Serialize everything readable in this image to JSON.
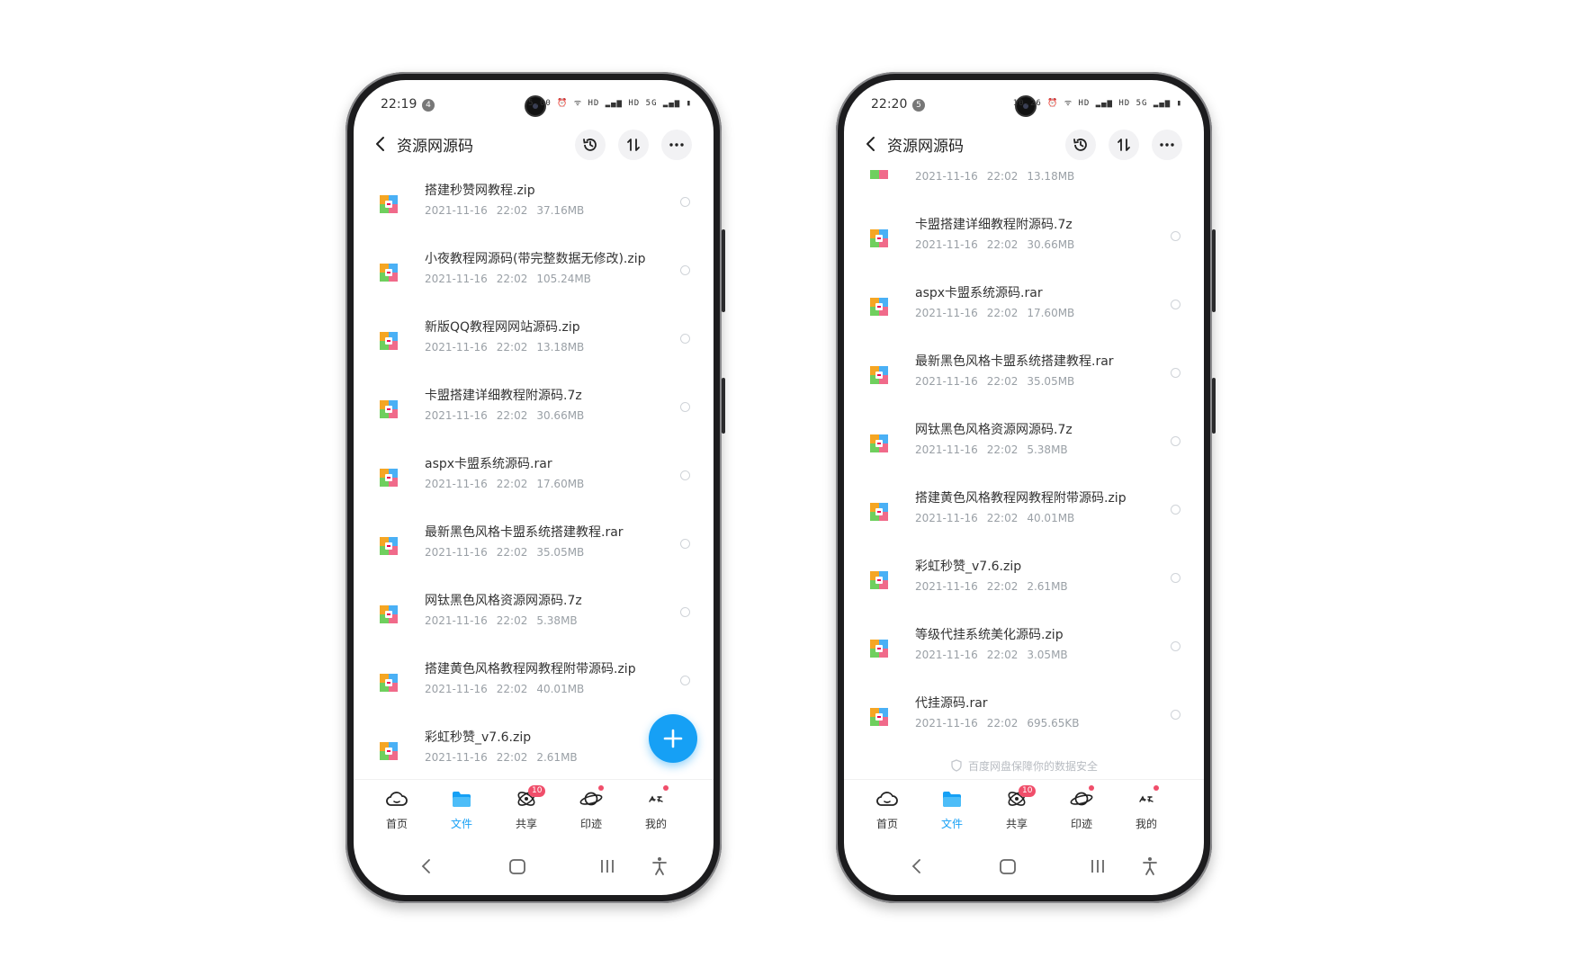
{
  "colors": {
    "accent": "#16a0f5",
    "badge": "#f04e6a"
  },
  "phones": [
    {
      "status": {
        "time": "22:19",
        "notif_count": "4",
        "icons": "5.00 ⏰ ᯤ HD ▂▄▆ HD 5G ▂▄▆ ▮"
      },
      "header": {
        "title": "资源网源码"
      },
      "files": [
        {
          "name": "搭建秒赞网教程.zip",
          "date": "2021-11-16",
          "time": "22:02",
          "size": "37.16MB"
        },
        {
          "name": "小夜教程网源码(带完整数据无修改).zip",
          "date": "2021-11-16",
          "time": "22:02",
          "size": "105.24MB"
        },
        {
          "name": "新版QQ教程网网站源码.zip",
          "date": "2021-11-16",
          "time": "22:02",
          "size": "13.18MB"
        },
        {
          "name": "卡盟搭建详细教程附源码.7z",
          "date": "2021-11-16",
          "time": "22:02",
          "size": "30.66MB"
        },
        {
          "name": "aspx卡盟系统源码.rar",
          "date": "2021-11-16",
          "time": "22:02",
          "size": "17.60MB"
        },
        {
          "name": "最新黑色风格卡盟系统搭建教程.rar",
          "date": "2021-11-16",
          "time": "22:02",
          "size": "35.05MB"
        },
        {
          "name": "网钛黑色风格资源网源码.7z",
          "date": "2021-11-16",
          "time": "22:02",
          "size": "5.38MB"
        },
        {
          "name": "搭建黄色风格教程网教程附带源码.zip",
          "date": "2021-11-16",
          "time": "22:02",
          "size": "40.01MB"
        },
        {
          "name": "彩虹秒赞_v7.6.zip",
          "date": "2021-11-16",
          "time": "22:02",
          "size": "2.61MB"
        }
      ],
      "tabs": [
        {
          "label": "首页"
        },
        {
          "label": "文件"
        },
        {
          "label": "共享",
          "badge": "10"
        },
        {
          "label": "印迹"
        },
        {
          "label": "我的"
        }
      ]
    },
    {
      "status": {
        "time": "22:20",
        "notif_count": "5",
        "icons": "10.26 ⏰ ᯤ HD ▂▄▆ HD 5G ▂▄▆ ▮"
      },
      "header": {
        "title": "资源网源码"
      },
      "partial_meta": {
        "date": "2021-11-16",
        "time": "22:02",
        "size": "13.18MB"
      },
      "files": [
        {
          "name": "卡盟搭建详细教程附源码.7z",
          "date": "2021-11-16",
          "time": "22:02",
          "size": "30.66MB"
        },
        {
          "name": "aspx卡盟系统源码.rar",
          "date": "2021-11-16",
          "time": "22:02",
          "size": "17.60MB"
        },
        {
          "name": "最新黑色风格卡盟系统搭建教程.rar",
          "date": "2021-11-16",
          "time": "22:02",
          "size": "35.05MB"
        },
        {
          "name": "网钛黑色风格资源网源码.7z",
          "date": "2021-11-16",
          "time": "22:02",
          "size": "5.38MB"
        },
        {
          "name": "搭建黄色风格教程网教程附带源码.zip",
          "date": "2021-11-16",
          "time": "22:02",
          "size": "40.01MB"
        },
        {
          "name": "彩虹秒赞_v7.6.zip",
          "date": "2021-11-16",
          "time": "22:02",
          "size": "2.61MB"
        },
        {
          "name": "等级代挂系统美化源码.zip",
          "date": "2021-11-16",
          "time": "22:02",
          "size": "3.05MB"
        },
        {
          "name": "代挂源码.rar",
          "date": "2021-11-16",
          "time": "22:02",
          "size": "695.65KB"
        }
      ],
      "footnote": "百度网盘保障你的数据安全",
      "tabs": [
        {
          "label": "首页"
        },
        {
          "label": "文件"
        },
        {
          "label": "共享",
          "badge": "10"
        },
        {
          "label": "印迹"
        },
        {
          "label": "我的"
        }
      ]
    }
  ]
}
